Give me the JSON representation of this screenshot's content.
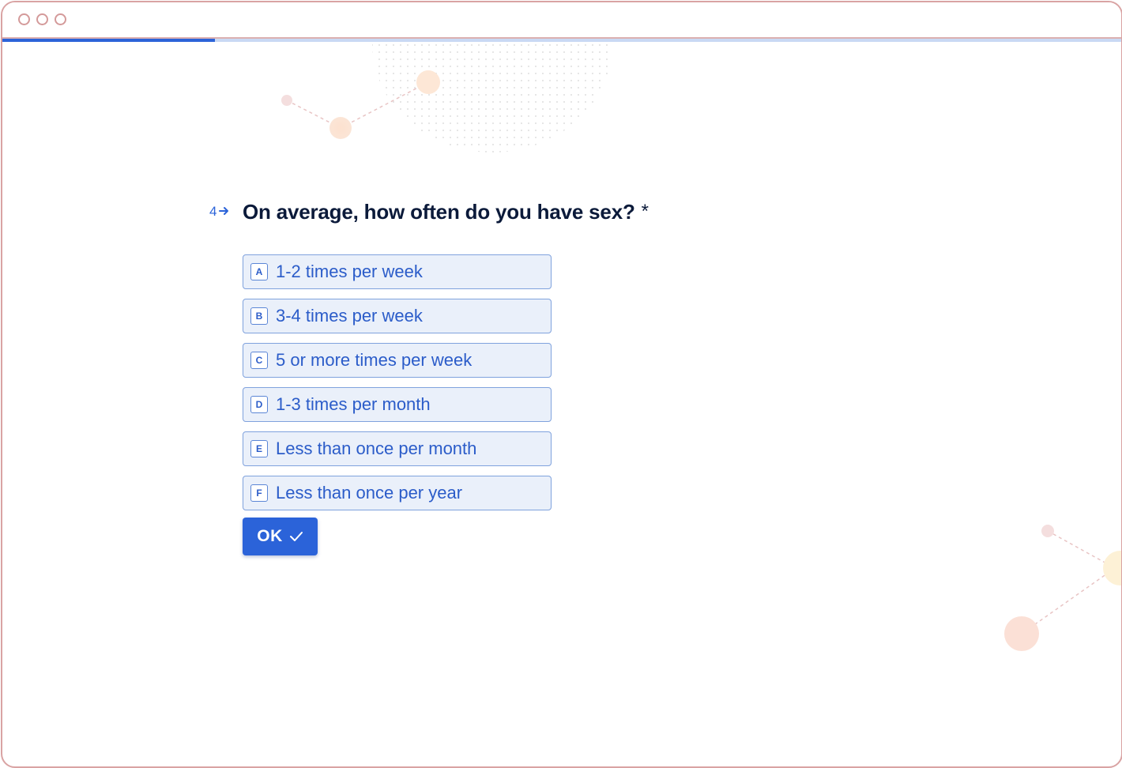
{
  "window": {
    "controls": [
      "window-dot",
      "window-dot",
      "window-dot"
    ]
  },
  "progress": {
    "fraction": 0.19,
    "fill_color": "#2b63d9",
    "track_color": "#c9d9f4"
  },
  "question": {
    "number": "4",
    "arrow_icon": "arrow-right-icon",
    "text": "On average, how often do you have sex?",
    "required_mark": "*"
  },
  "choices": [
    {
      "key": "A",
      "label": "1-2 times per week"
    },
    {
      "key": "B",
      "label": "3-4 times per week"
    },
    {
      "key": "C",
      "label": "5 or more times per week"
    },
    {
      "key": "D",
      "label": "1-3 times per month"
    },
    {
      "key": "E",
      "label": "Less than once per month"
    },
    {
      "key": "F",
      "label": "Less than once per year"
    }
  ],
  "submit": {
    "label": "OK",
    "icon": "check-icon"
  },
  "colors": {
    "accent": "#2b63d9",
    "frame_border": "#d9a3a3",
    "question_text": "#0b1a3a",
    "choice_background": "#eaf0fa"
  }
}
